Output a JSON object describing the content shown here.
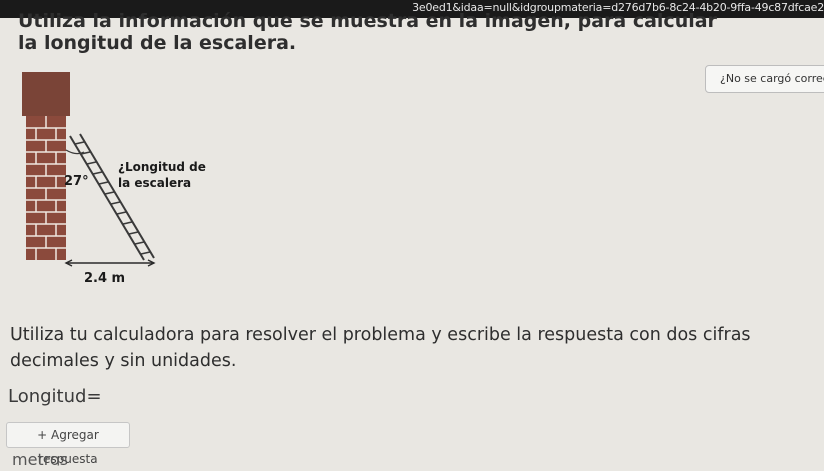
{
  "browser": {
    "url_text": "3e0ed1&idaa=null&idgroupmateria=d276d7b6-8c24-4b20-9ffa-49c87dfcae2"
  },
  "question": {
    "text": "Utiliza la información que se muestra en la imagen, para calcular la longitud de la escalera."
  },
  "notice": {
    "text": "¿No se cargó correctamente?"
  },
  "figure": {
    "angle_label": "27°",
    "ladder_label_line1": "¿Longitud de",
    "ladder_label_line2": "la escalera",
    "base_label": "2.4 m",
    "wall_color": "#8b4a3c",
    "wall_cap_color": "#7a4437"
  },
  "instructions": {
    "text": "Utiliza tu calculadora para resolver el problema y escribe la respuesta con dos cifras decimales y sin unidades."
  },
  "answer": {
    "label": "Longitud=",
    "add_button": "+ Agregar respuesta",
    "units": "metros"
  }
}
